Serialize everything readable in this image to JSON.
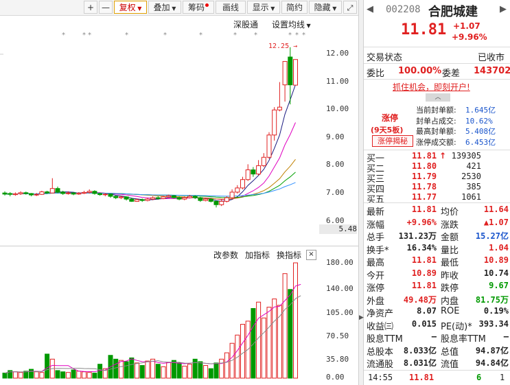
{
  "toolbar": {
    "plus": "+",
    "minus": "—",
    "fuquan": "复权",
    "diejia": "叠加",
    "chouma": "筹码",
    "huaxian": "画线",
    "xianshi": "显示",
    "jianyue": "简约",
    "yincang": "隐藏"
  },
  "chart_top": {
    "shengutong": "深股通",
    "set_ma": "设置均线",
    "high_marker": "12.25",
    "y_ticks": [
      "12.00",
      "11.00",
      "10.00",
      "9.00",
      "8.00",
      "7.00",
      "6.00"
    ],
    "bottom_value": "5.48"
  },
  "chart_bottom": {
    "tab1": "改参数",
    "tab2": "加指标",
    "tab3": "换指标",
    "close": "×",
    "y_ticks": [
      "180.00",
      "140.00",
      "105.00",
      "70.50",
      "35.80",
      "0.00"
    ]
  },
  "chart_data": {
    "type": "candlestick",
    "price_range": [
      5.48,
      12.25
    ],
    "candles": [
      {
        "o": 7.02,
        "c": 6.98,
        "h": 7.08,
        "l": 6.93
      },
      {
        "o": 7.0,
        "c": 6.97,
        "h": 7.05,
        "l": 6.9
      },
      {
        "o": 6.96,
        "c": 6.99,
        "h": 7.04,
        "l": 6.92
      },
      {
        "o": 6.99,
        "c": 7.03,
        "h": 7.08,
        "l": 6.95
      },
      {
        "o": 7.03,
        "c": 7.0,
        "h": 7.07,
        "l": 6.96
      },
      {
        "o": 7.0,
        "c": 6.95,
        "h": 7.02,
        "l": 6.9
      },
      {
        "o": 6.95,
        "c": 6.97,
        "h": 7.02,
        "l": 6.91
      },
      {
        "o": 6.97,
        "c": 7.06,
        "h": 7.1,
        "l": 6.95
      },
      {
        "o": 7.06,
        "c": 7.02,
        "h": 7.1,
        "l": 6.99
      },
      {
        "o": 7.02,
        "c": 7.18,
        "h": 7.55,
        "l": 7.0
      },
      {
        "o": 7.18,
        "c": 7.05,
        "h": 7.25,
        "l": 7.02
      },
      {
        "o": 7.05,
        "c": 7.0,
        "h": 7.1,
        "l": 6.95
      },
      {
        "o": 7.0,
        "c": 7.02,
        "h": 7.08,
        "l": 6.96
      },
      {
        "o": 7.02,
        "c": 6.98,
        "h": 7.05,
        "l": 6.94
      },
      {
        "o": 6.98,
        "c": 7.01,
        "h": 7.05,
        "l": 6.95
      },
      {
        "o": 7.01,
        "c": 7.04,
        "h": 7.1,
        "l": 6.98
      },
      {
        "o": 7.04,
        "c": 7.08,
        "h": 7.15,
        "l": 7.0
      },
      {
        "o": 7.08,
        "c": 7.0,
        "h": 7.12,
        "l": 6.96
      },
      {
        "o": 7.0,
        "c": 6.96,
        "h": 7.03,
        "l": 6.92
      },
      {
        "o": 6.96,
        "c": 6.98,
        "h": 7.02,
        "l": 6.9
      },
      {
        "o": 6.98,
        "c": 6.9,
        "h": 7.0,
        "l": 6.85
      },
      {
        "o": 6.9,
        "c": 6.85,
        "h": 6.93,
        "l": 6.8
      },
      {
        "o": 6.85,
        "c": 6.88,
        "h": 6.92,
        "l": 6.8
      },
      {
        "o": 6.88,
        "c": 6.8,
        "h": 6.9,
        "l": 6.75
      },
      {
        "o": 6.8,
        "c": 6.72,
        "h": 6.85,
        "l": 6.7
      },
      {
        "o": 6.72,
        "c": 6.78,
        "h": 6.82,
        "l": 6.7
      },
      {
        "o": 6.78,
        "c": 6.75,
        "h": 6.82,
        "l": 6.7
      },
      {
        "o": 6.75,
        "c": 6.8,
        "h": 6.85,
        "l": 6.72
      },
      {
        "o": 6.8,
        "c": 6.85,
        "h": 6.9,
        "l": 6.76
      },
      {
        "o": 6.85,
        "c": 6.82,
        "h": 6.9,
        "l": 6.78
      },
      {
        "o": 6.82,
        "c": 6.88,
        "h": 6.92,
        "l": 6.8
      },
      {
        "o": 6.88,
        "c": 6.92,
        "h": 6.96,
        "l": 6.84
      },
      {
        "o": 6.92,
        "c": 6.85,
        "h": 6.95,
        "l": 6.82
      },
      {
        "o": 6.85,
        "c": 6.8,
        "h": 6.9,
        "l": 6.76
      },
      {
        "o": 6.8,
        "c": 6.85,
        "h": 6.9,
        "l": 6.76
      },
      {
        "o": 6.85,
        "c": 6.9,
        "h": 6.95,
        "l": 6.82
      },
      {
        "o": 6.9,
        "c": 6.85,
        "h": 6.94,
        "l": 6.8
      },
      {
        "o": 6.85,
        "c": 6.75,
        "h": 6.88,
        "l": 6.7
      },
      {
        "o": 6.75,
        "c": 6.8,
        "h": 6.85,
        "l": 6.72
      },
      {
        "o": 6.8,
        "c": 6.72,
        "h": 6.84,
        "l": 6.68
      },
      {
        "o": 6.72,
        "c": 6.6,
        "h": 6.75,
        "l": 6.5
      },
      {
        "o": 6.6,
        "c": 6.72,
        "h": 6.8,
        "l": 6.55
      },
      {
        "o": 6.72,
        "c": 6.85,
        "h": 6.9,
        "l": 6.68
      },
      {
        "o": 6.85,
        "c": 7.05,
        "h": 7.15,
        "l": 6.8
      },
      {
        "o": 7.05,
        "c": 7.2,
        "h": 7.3,
        "l": 7.0
      },
      {
        "o": 7.2,
        "c": 7.5,
        "h": 7.6,
        "l": 7.15
      },
      {
        "o": 7.5,
        "c": 7.85,
        "h": 8.05,
        "l": 7.45
      },
      {
        "o": 7.85,
        "c": 7.7,
        "h": 7.95,
        "l": 7.6
      },
      {
        "o": 7.7,
        "c": 8.0,
        "h": 8.2,
        "l": 7.65
      },
      {
        "o": 8.0,
        "c": 8.3,
        "h": 8.45,
        "l": 7.95
      },
      {
        "o": 8.3,
        "c": 9.1,
        "h": 9.2,
        "l": 8.25
      },
      {
        "o": 9.1,
        "c": 10.0,
        "h": 10.1,
        "l": 8.9
      },
      {
        "o": 10.0,
        "c": 10.1,
        "h": 11.0,
        "l": 9.95
      },
      {
        "o": 10.9,
        "c": 11.74,
        "h": 11.74,
        "l": 10.3
      },
      {
        "o": 11.9,
        "c": 10.9,
        "h": 12.25,
        "l": 10.2
      },
      {
        "o": 10.89,
        "c": 11.81,
        "h": 11.81,
        "l": 10.89
      }
    ],
    "volumes": [
      8,
      12,
      10,
      9,
      11,
      14,
      10,
      9,
      38,
      30,
      12,
      10,
      9,
      13,
      11,
      10,
      9,
      8,
      22,
      15,
      36,
      30,
      28,
      26,
      32,
      24,
      20,
      27,
      30,
      22,
      18,
      25,
      28,
      24,
      19,
      22,
      30,
      26,
      20,
      15,
      24,
      30,
      40,
      55,
      68,
      85,
      90,
      110,
      120,
      95,
      112,
      125,
      115,
      165,
      140,
      182,
      138
    ],
    "vol_range": [
      0,
      182
    ]
  },
  "panel": {
    "code": "002208",
    "name": "合肥城建",
    "price": "11.81",
    "change": "+1.07",
    "change_pct": "+9.96%",
    "status_label": "交易状态",
    "status_value": "已收市",
    "weibi_label": "委比",
    "weibi_value": "100.00%",
    "weicha_label": "委差",
    "weicha_value": "143702",
    "promo": "抓住机会，即刻开户!",
    "zt_label": "涨停",
    "zt_days": "(9天5板)",
    "zt_btn": "涨停揭秘",
    "fd": [
      {
        "label": "当前封单额:",
        "value": "1.645亿"
      },
      {
        "label": "封单占成交:",
        "value": "10.62%"
      },
      {
        "label": "最高封单额:",
        "value": "5.408亿"
      },
      {
        "label": "涨停成交额:",
        "value": "6.453亿"
      }
    ],
    "bids": [
      {
        "label": "买一",
        "price": "11.81",
        "arrow": "↑",
        "vol": "139305"
      },
      {
        "label": "买二",
        "price": "11.80",
        "arrow": "",
        "vol": "421"
      },
      {
        "label": "买三",
        "price": "11.79",
        "arrow": "",
        "vol": "2530"
      },
      {
        "label": "买四",
        "price": "11.78",
        "arrow": "",
        "vol": "385"
      },
      {
        "label": "买五",
        "price": "11.77",
        "arrow": "",
        "vol": "1061"
      }
    ],
    "stats": [
      {
        "l1": "最新",
        "v1": "11.81",
        "c1": "red",
        "l2": "均价",
        "v2": "11.64",
        "c2": "red"
      },
      {
        "l1": "涨幅",
        "v1": "+9.96%",
        "c1": "red",
        "l2": "涨跌",
        "v2": "▲1.07",
        "c2": "red"
      },
      {
        "l1": "总手",
        "v1": "131.23万",
        "c1": "",
        "l2": "金额",
        "v2": "15.27亿",
        "c2": "blue"
      },
      {
        "l1": "换手*",
        "v1": "16.34%",
        "c1": "",
        "l2": "量比",
        "v2": "1.04",
        "c2": "red"
      },
      {
        "l1": "最高",
        "v1": "11.81",
        "c1": "red",
        "l2": "最低",
        "v2": "10.89",
        "c2": "red"
      },
      {
        "l1": "今开",
        "v1": "10.89",
        "c1": "red",
        "l2": "昨收",
        "v2": "10.74",
        "c2": ""
      },
      {
        "l1": "涨停",
        "v1": "11.81",
        "c1": "red",
        "l2": "跌停",
        "v2": "9.67",
        "c2": "green"
      },
      {
        "l1": "外盘",
        "v1": "49.48万",
        "c1": "red",
        "l2": "内盘",
        "v2": "81.75万",
        "c2": "green"
      },
      {
        "l1": "净资产",
        "v1": "8.07",
        "c1": "",
        "l2": "ROE",
        "v2": "0.19%",
        "c2": ""
      },
      {
        "l1": "收益㈢",
        "v1": "0.015",
        "c1": "",
        "l2": "PE(动)*",
        "v2": "393.34",
        "c2": ""
      },
      {
        "l1": "股息TTM",
        "v1": "—",
        "c1": "",
        "l2": "股息率TTM",
        "v2": "—",
        "c2": ""
      },
      {
        "l1": "总股本",
        "v1": "8.033亿",
        "c1": "",
        "l2": "总值",
        "v2": "94.87亿",
        "c2": ""
      },
      {
        "l1": "流通股",
        "v1": "8.031亿",
        "c1": "",
        "l2": "流值",
        "v2": "94.84亿",
        "c2": ""
      }
    ],
    "tick": {
      "time": "14:55",
      "price": "11.81",
      "vol": "6",
      "num": "1"
    }
  },
  "colors": {
    "up": "#e02020",
    "down": "#009900",
    "accent": "#1a55cc"
  }
}
